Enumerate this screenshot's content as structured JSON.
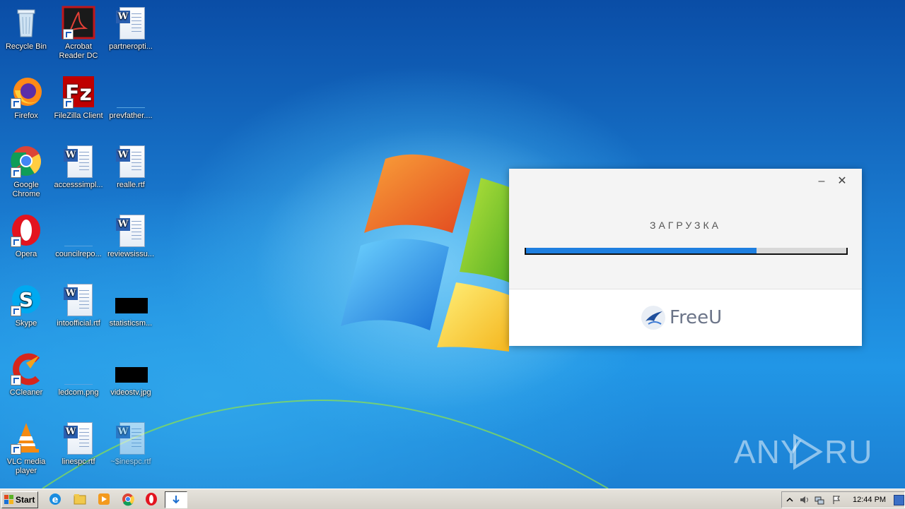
{
  "desktop_icons": [
    {
      "label": "Recycle Bin",
      "icon": "recycle-bin-icon"
    },
    {
      "label": "Acrobat Reader DC",
      "icon": "acrobat-icon"
    },
    {
      "label": "partneropti...",
      "icon": "word-doc-icon"
    },
    {
      "label": "Firefox",
      "icon": "firefox-icon"
    },
    {
      "label": "FileZilla Client",
      "icon": "filezilla-icon"
    },
    {
      "label": "prevfather....",
      "icon": "blank-file-icon"
    },
    {
      "label": "Google Chrome",
      "icon": "chrome-icon"
    },
    {
      "label": "accesssimpl...",
      "icon": "word-doc-icon"
    },
    {
      "label": "realle.rtf",
      "icon": "word-doc-icon"
    },
    {
      "label": "Opera",
      "icon": "opera-icon"
    },
    {
      "label": "councilrepo...",
      "icon": "blank-file-icon"
    },
    {
      "label": "reviewsissu...",
      "icon": "word-doc-icon"
    },
    {
      "label": "Skype",
      "icon": "skype-icon"
    },
    {
      "label": "intoofficial.rtf",
      "icon": "word-doc-icon"
    },
    {
      "label": "statisticsm...",
      "icon": "image-thumb-icon"
    },
    {
      "label": "CCleaner",
      "icon": "ccleaner-icon"
    },
    {
      "label": "ledcom.png",
      "icon": "blank-file-icon"
    },
    {
      "label": "videostv.jpg",
      "icon": "image-thumb-icon"
    },
    {
      "label": "VLC media player",
      "icon": "vlc-icon"
    },
    {
      "label": "linespc.rtf",
      "icon": "word-doc-icon"
    },
    {
      "label": "~$inespc.rtf",
      "icon": "word-doc-icon"
    }
  ],
  "dialog": {
    "minimize_label": "–",
    "close_label": "✕",
    "loading_text": "ЗАГРУЗКА",
    "progress_fraction": 0.72,
    "brand_name": "FreeU"
  },
  "taskbar": {
    "start_label": "Start",
    "clock": "12:44 PM",
    "quick_launch": [
      "internet-explorer-icon",
      "folder-icon",
      "media-player-icon",
      "chrome-icon",
      "opera-icon"
    ],
    "active_task": "download-task-icon"
  },
  "watermark": "ANY RUN",
  "colors": {
    "progress_fill": "#1e7fe0",
    "desktop_blue": "#1a7bd0"
  }
}
